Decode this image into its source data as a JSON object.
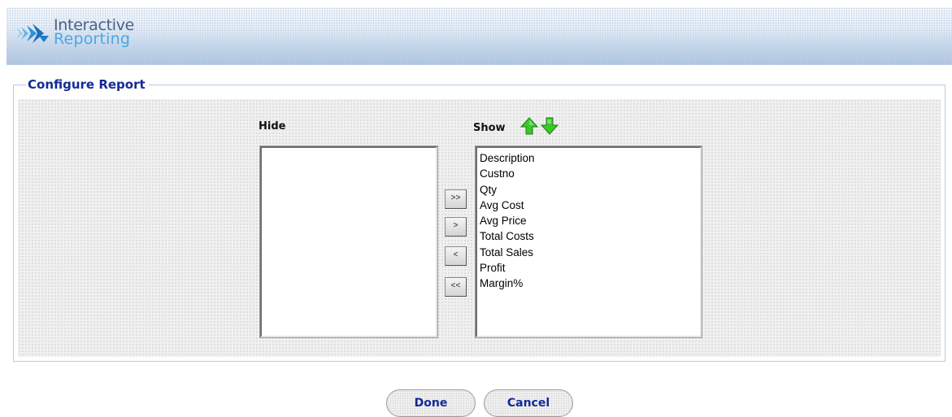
{
  "app": {
    "logo_line1": "Interactive",
    "logo_line2": "Reporting"
  },
  "config": {
    "legend": "Configure Report",
    "hide_label": "Hide",
    "show_label": "Show",
    "hide_items": [],
    "show_items": [
      "Description",
      "Custno",
      "Qty",
      "Avg Cost",
      "Avg Price",
      "Total Costs",
      "Total Sales",
      "Profit",
      "Margin%"
    ],
    "move_all_right": ">>",
    "move_right": ">",
    "move_left": "<",
    "move_all_left": "<<"
  },
  "actions": {
    "done": "Done",
    "cancel": "Cancel"
  },
  "colors": {
    "legend_text": "#142a96",
    "arrow_green": "#33c01f"
  }
}
